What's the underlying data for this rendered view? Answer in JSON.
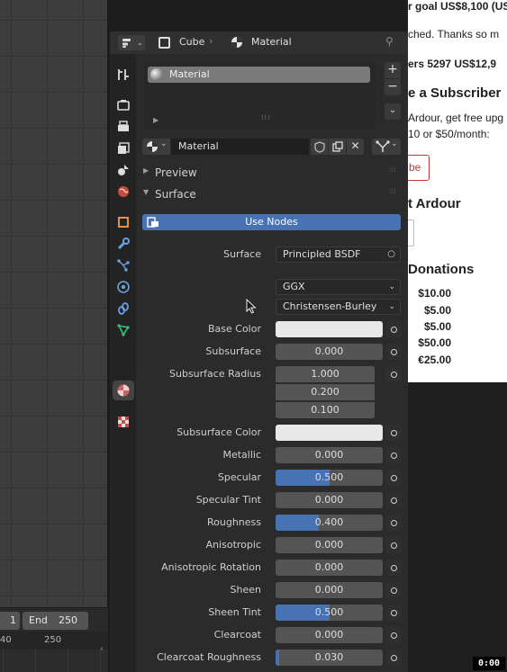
{
  "webpage": {
    "line1": "r goal US$8,100 (US",
    "line2": "ched. Thanks so m",
    "line3": "ers 5297 US$12,9",
    "heading1": "e a Subscriber",
    "line4": "Ardour, get free upg",
    "line5": "10 or $50/month:",
    "button": "be",
    "heading2": "t Ardour",
    "heading3": "Donations",
    "donations": [
      "$10.00",
      "$5.00",
      "$5.00",
      "$50.00",
      "€25.00"
    ]
  },
  "timeline": {
    "start_partial": "1",
    "end_label": "End",
    "end_value": "250",
    "ruler_left": "40",
    "ruler_mark": "250"
  },
  "clock": "0:00",
  "header": {
    "object_name": "Cube",
    "separator": "›",
    "tab_name": "Material"
  },
  "material_slots": {
    "items": [
      "Material"
    ]
  },
  "datablock": {
    "name": "Material"
  },
  "panels": {
    "preview": "Preview",
    "surface": "Surface"
  },
  "use_nodes_label": "Use Nodes",
  "surface": {
    "label": "Surface",
    "shader": "Principled BSDF",
    "distribution": "GGX",
    "subsurface_method": "Christensen-Burley"
  },
  "props": {
    "base_color": {
      "label": "Base Color",
      "color": "#e8e8e8"
    },
    "subsurface": {
      "label": "Subsurface",
      "value": "0.000",
      "fraction": 0.0
    },
    "subsurface_radius": {
      "label": "Subsurface Radius",
      "values": [
        "1.000",
        "0.200",
        "0.100"
      ]
    },
    "subsurface_color": {
      "label": "Subsurface Color",
      "color": "#e8e8e8"
    },
    "metallic": {
      "label": "Metallic",
      "value": "0.000",
      "fraction": 0.0
    },
    "specular": {
      "label": "Specular",
      "value": "0.500",
      "fraction": 0.5
    },
    "specular_tint": {
      "label": "Specular Tint",
      "value": "0.000",
      "fraction": 0.0
    },
    "roughness": {
      "label": "Roughness",
      "value": "0.400",
      "fraction": 0.4
    },
    "anisotropic": {
      "label": "Anisotropic",
      "value": "0.000",
      "fraction": 0.0
    },
    "anisotropic_rotation": {
      "label": "Anisotropic Rotation",
      "value": "0.000",
      "fraction": 0.0
    },
    "sheen": {
      "label": "Sheen",
      "value": "0.000",
      "fraction": 0.0
    },
    "sheen_tint": {
      "label": "Sheen Tint",
      "value": "0.500",
      "fraction": 0.5
    },
    "clearcoat": {
      "label": "Clearcoat",
      "value": "0.000",
      "fraction": 0.0
    },
    "clearcoat_roughness": {
      "label": "Clearcoat Roughness",
      "value": "0.030",
      "fraction": 0.03
    }
  },
  "colors": {
    "accent": "#4772b3",
    "panel_bg": "#2b2b2b",
    "field_bg": "#545454"
  },
  "icons": [
    "editor-type-icon",
    "object-data-icon",
    "material-icon",
    "pin-icon",
    "tool-icon",
    "render-icon",
    "output-icon",
    "view-layer-icon",
    "scene-icon",
    "world-icon",
    "object-icon",
    "modifier-icon",
    "particles-icon",
    "physics-icon",
    "constraints-icon",
    "data-icon",
    "material-tab-icon",
    "texture-icon",
    "add-icon",
    "remove-icon",
    "chevron-down-icon",
    "fake-user-icon",
    "duplicate-icon",
    "close-icon",
    "node-icon",
    "cursor-icon"
  ]
}
